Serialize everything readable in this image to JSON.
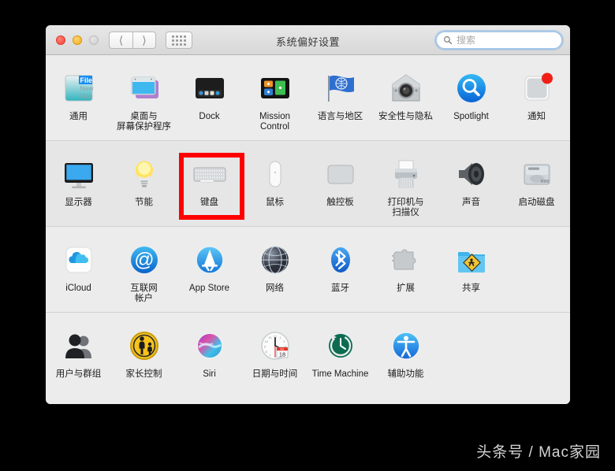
{
  "window": {
    "title": "系统偏好设置",
    "traffic_lights": [
      "close",
      "minimize",
      "zoom"
    ],
    "nav_back_icon": "chevron-left-icon",
    "nav_forward_icon": "chevron-right-icon",
    "grid_button_icon": "grid-dots-icon"
  },
  "search": {
    "value": "",
    "placeholder": "搜索",
    "icon": "search-icon"
  },
  "rows": [
    {
      "band": false,
      "items": [
        {
          "label": "通用",
          "icon": "general-icon"
        },
        {
          "label": "桌面与\n屏幕保护程序",
          "icon": "desktop-screensaver-icon"
        },
        {
          "label": "Dock",
          "icon": "dock-icon"
        },
        {
          "label": "Mission\nControl",
          "icon": "mission-control-icon"
        },
        {
          "label": "语言与地区",
          "icon": "language-region-icon"
        },
        {
          "label": "安全性与隐私",
          "icon": "security-privacy-icon"
        },
        {
          "label": "Spotlight",
          "icon": "spotlight-icon"
        },
        {
          "label": "通知",
          "icon": "notifications-icon"
        }
      ]
    },
    {
      "band": true,
      "items": [
        {
          "label": "显示器",
          "icon": "displays-icon"
        },
        {
          "label": "节能",
          "icon": "energy-saver-icon"
        },
        {
          "label": "键盘",
          "icon": "keyboard-icon",
          "highlighted": true
        },
        {
          "label": "鼠标",
          "icon": "mouse-icon"
        },
        {
          "label": "触控板",
          "icon": "trackpad-icon"
        },
        {
          "label": "打印机与\n扫描仪",
          "icon": "printers-scanners-icon"
        },
        {
          "label": "声音",
          "icon": "sound-icon"
        },
        {
          "label": "启动磁盘",
          "icon": "startup-disk-icon"
        }
      ]
    },
    {
      "band": false,
      "items": [
        {
          "label": "iCloud",
          "icon": "icloud-icon"
        },
        {
          "label": "互联网\n帐户",
          "icon": "internet-accounts-icon"
        },
        {
          "label": "App Store",
          "icon": "app-store-icon"
        },
        {
          "label": "网络",
          "icon": "network-icon"
        },
        {
          "label": "蓝牙",
          "icon": "bluetooth-icon"
        },
        {
          "label": "扩展",
          "icon": "extensions-icon"
        },
        {
          "label": "共享",
          "icon": "sharing-icon"
        }
      ]
    },
    {
      "band": false,
      "items": [
        {
          "label": "用户与群组",
          "icon": "users-groups-icon"
        },
        {
          "label": "家长控制",
          "icon": "parental-controls-icon"
        },
        {
          "label": "Siri",
          "icon": "siri-icon"
        },
        {
          "label": "日期与时间",
          "icon": "date-time-icon",
          "badge_month": "JUL",
          "badge_day": "18"
        },
        {
          "label": "Time Machine",
          "icon": "time-machine-icon"
        },
        {
          "label": "辅助功能",
          "icon": "accessibility-icon"
        }
      ]
    }
  ],
  "highlight": {
    "target_label": "键盘",
    "color": "#ff0000"
  },
  "watermark": {
    "text": "头条号 / Mac家园"
  }
}
